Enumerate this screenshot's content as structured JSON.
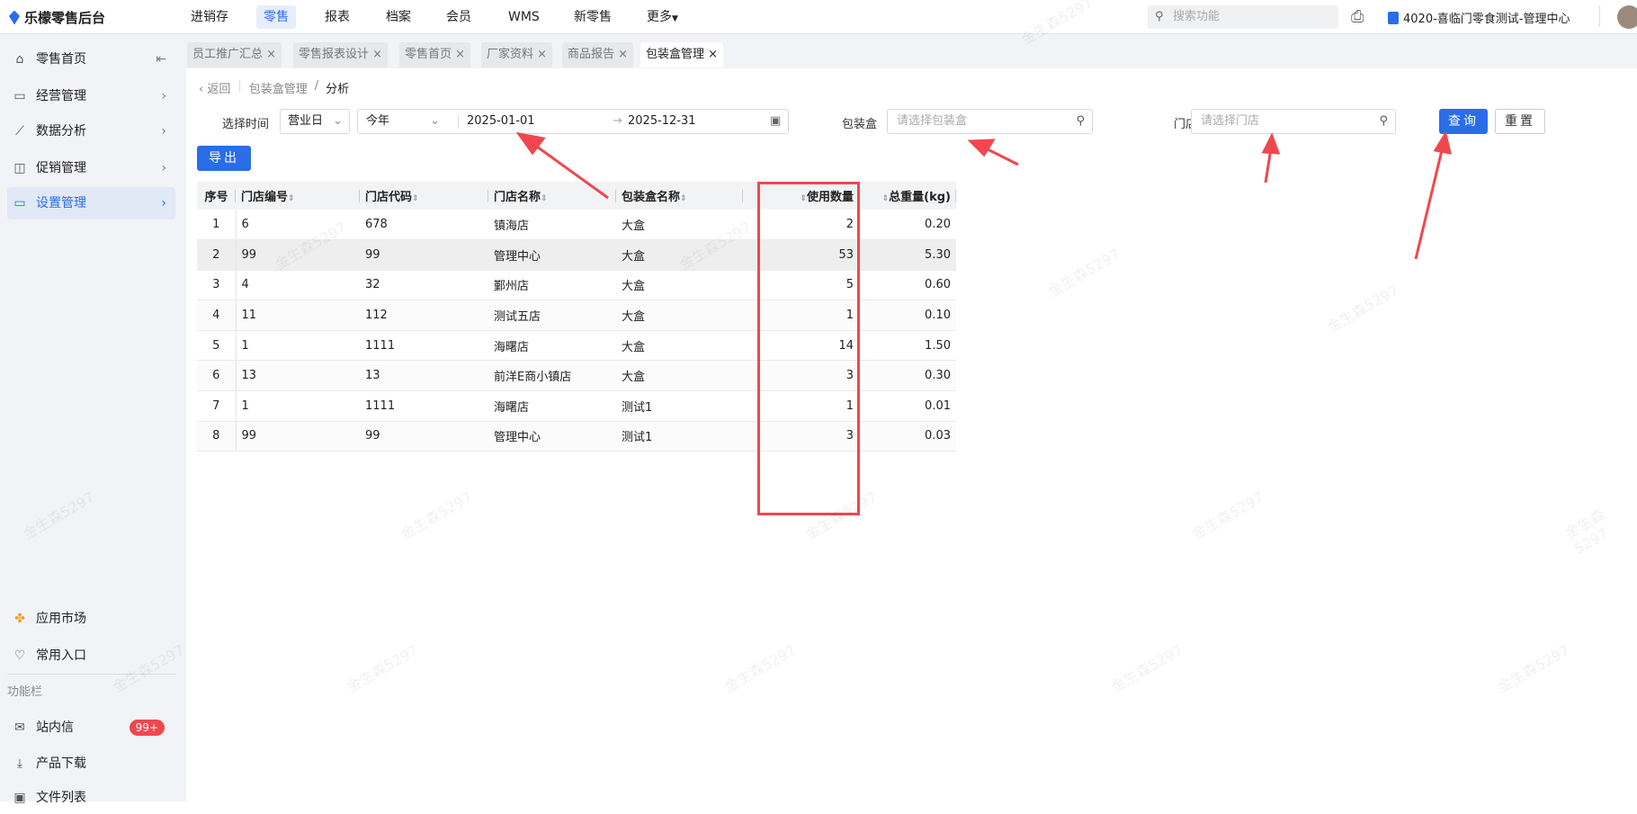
{
  "app": {
    "title": "乐檬零售后台"
  },
  "topnav": {
    "items": [
      "进销存",
      "零售",
      "报表",
      "档案",
      "会员",
      "WMS",
      "新零售",
      "更多"
    ],
    "active": "零售",
    "search_placeholder": "搜索功能",
    "org": "4020-喜临门零食测试-管理中心"
  },
  "sidebar": {
    "items": [
      {
        "label": "零售首页",
        "icon": "home-icon"
      },
      {
        "label": "经营管理",
        "icon": "monitor-icon"
      },
      {
        "label": "数据分析",
        "icon": "chart-icon"
      },
      {
        "label": "促销管理",
        "icon": "promo-icon"
      },
      {
        "label": "设置管理",
        "icon": "folder-icon"
      }
    ],
    "bottom": {
      "app_market": "应用市场",
      "favorites": "常用入口",
      "section": "功能栏",
      "messages": "站内信",
      "messages_badge": "99+",
      "downloads": "产品下载",
      "files": "文件列表"
    }
  },
  "tabs": [
    "员工推广汇总",
    "零售报表设计",
    "零售首页",
    "厂家资料",
    "商品报告",
    "包装盒管理"
  ],
  "breadcrumb": {
    "back": "返回",
    "parent": "包装盒管理",
    "sep": "/",
    "current": "分析"
  },
  "filters": {
    "time_label": "选择时间",
    "time_type": "营业日",
    "period": "今年",
    "start": "2025-01-01",
    "end": "2025-12-31",
    "box_label": "包装盒",
    "box_placeholder": "请选择包装盒",
    "store_label": "门店",
    "store_placeholder": "请选择门店",
    "query": "查询",
    "reset": "重置",
    "export": "导出"
  },
  "table": {
    "headers": [
      "序号",
      "门店编号",
      "门店代码",
      "门店名称",
      "包装盒名称",
      "使用数量",
      "总重量(kg)"
    ],
    "rows": [
      [
        "1",
        "6",
        "678",
        "镇海店",
        "大盒",
        "2",
        "0.20"
      ],
      [
        "2",
        "99",
        "99",
        "管理中心",
        "大盒",
        "53",
        "5.30"
      ],
      [
        "3",
        "4",
        "32",
        "鄞州店",
        "大盒",
        "5",
        "0.60"
      ],
      [
        "4",
        "11",
        "112",
        "测试五店",
        "大盒",
        "1",
        "0.10"
      ],
      [
        "5",
        "1",
        "1111",
        "海曙店",
        "大盒",
        "14",
        "1.50"
      ],
      [
        "6",
        "13",
        "13",
        "前洋E商小镇店",
        "大盒",
        "3",
        "0.30"
      ],
      [
        "7",
        "1",
        "1111",
        "海曙店",
        "测试1",
        "1",
        "0.01"
      ],
      [
        "8",
        "99",
        "99",
        "管理中心",
        "测试1",
        "3",
        "0.03"
      ]
    ]
  },
  "watermark": "金生森5297"
}
